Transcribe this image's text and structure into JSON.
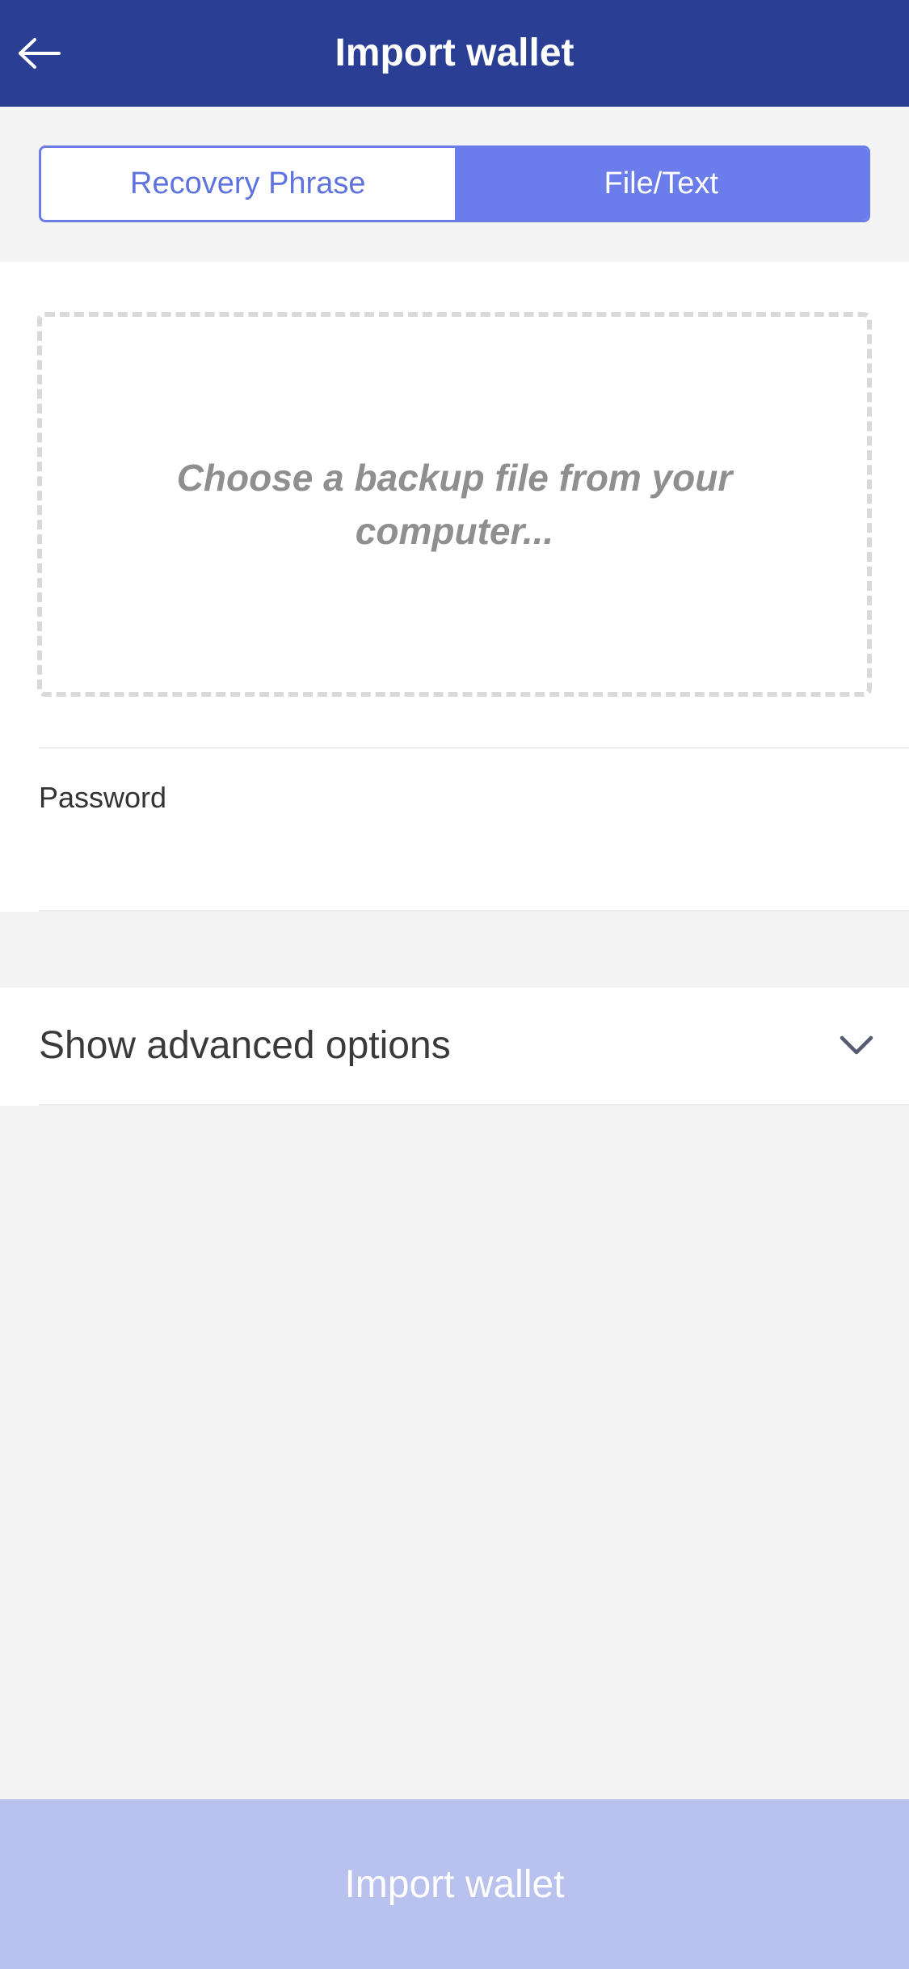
{
  "header": {
    "title": "Import wallet",
    "back_icon": "arrow-left-icon",
    "background_color": "#2a3f93"
  },
  "tabs": {
    "items": [
      {
        "label": "Recovery Phrase",
        "active": false
      },
      {
        "label": "File/Text",
        "active": true
      }
    ],
    "accent_color": "#6a7dea"
  },
  "file_picker": {
    "text": "Choose a backup file from your computer..."
  },
  "password": {
    "label": "Password",
    "value": "",
    "placeholder": ""
  },
  "advanced": {
    "label": "Show advanced options",
    "icon": "chevron-down-icon"
  },
  "footer": {
    "import_label": "Import wallet",
    "button_color": "#b9c1ee"
  }
}
